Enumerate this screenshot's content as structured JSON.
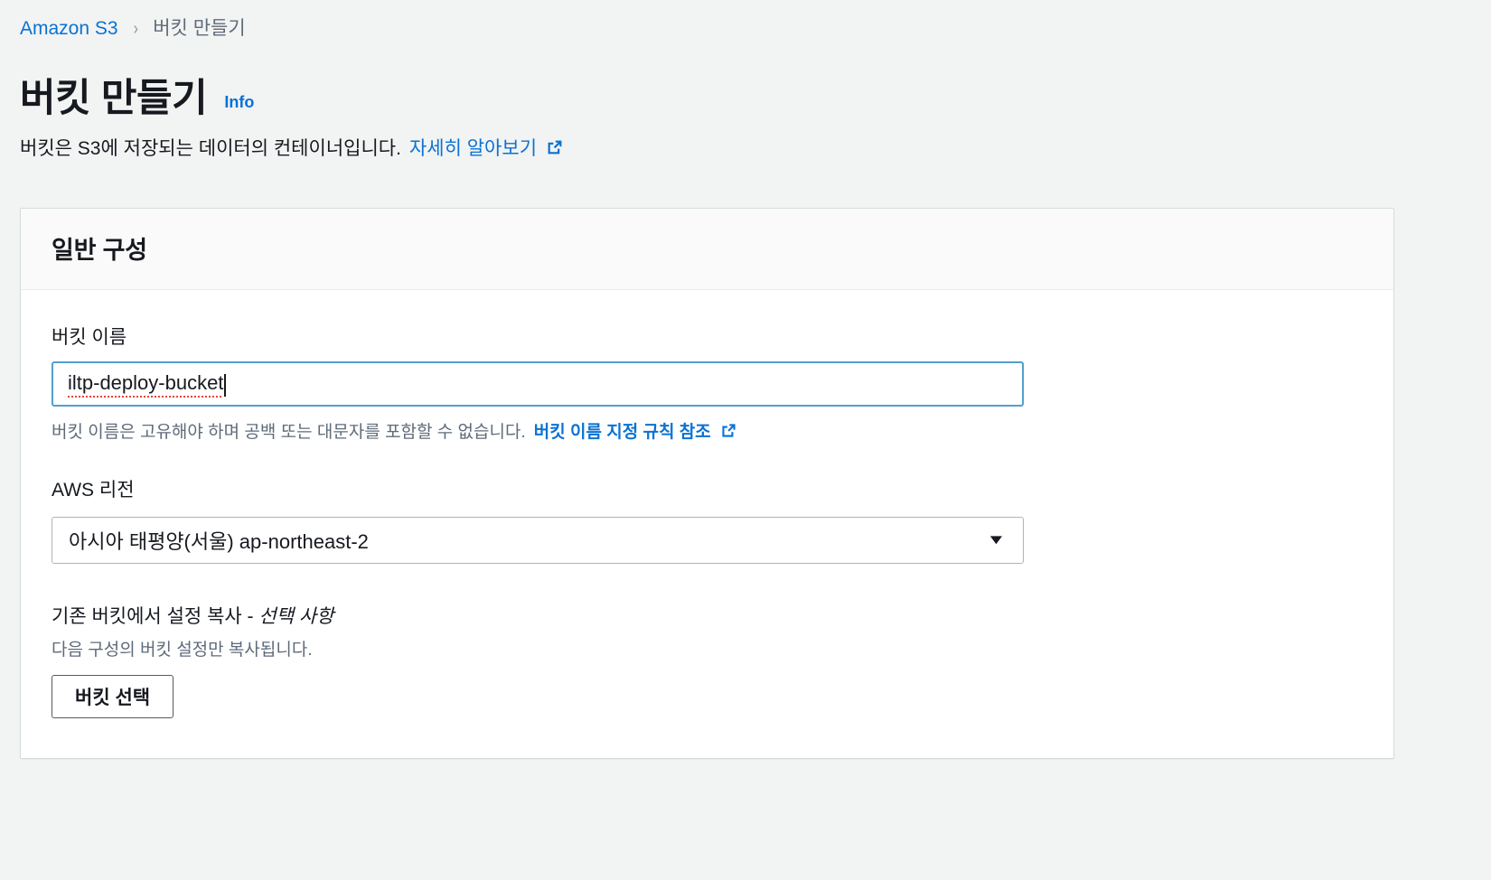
{
  "breadcrumb": {
    "root": "Amazon S3",
    "separator": "›",
    "current": "버킷 만들기"
  },
  "header": {
    "title": "버킷 만들기",
    "info_label": "Info",
    "description": "버킷은 S3에 저장되는 데이터의 컨테이너입니다.",
    "description_link": "자세히 알아보기"
  },
  "card": {
    "title": "일반 구성"
  },
  "bucket_name": {
    "label": "버킷 이름",
    "value": "iltp-deploy-bucket",
    "placeholder": "버킷 이름",
    "helper_text": "버킷 이름은 고유해야 하며 공백 또는 대문자를 포함할 수 없습니다.",
    "helper_link": "버킷 이름 지정 규칙 참조"
  },
  "region": {
    "label": "AWS 리전",
    "selected": "아시아 태평양(서울) ap-northeast-2",
    "chevron": "▼"
  },
  "copy_settings": {
    "title": "기존 버킷에서 설정 복사 - ",
    "title_optional": "선택 사항",
    "description": "다음 구성의 버킷 설정만 복사됩니다.",
    "button_label": "버킷 선택"
  },
  "colors": {
    "link": "#0972d3",
    "page_background": "#f2f3f3",
    "input_focus_border": "#539fcd",
    "spellcheck_underline": "#e8443a",
    "text_primary": "#16191f",
    "text_secondary": "#5f6b7a"
  },
  "icons": {
    "external_link": "external-link-icon",
    "chevron_down": "chevron-down-icon"
  }
}
